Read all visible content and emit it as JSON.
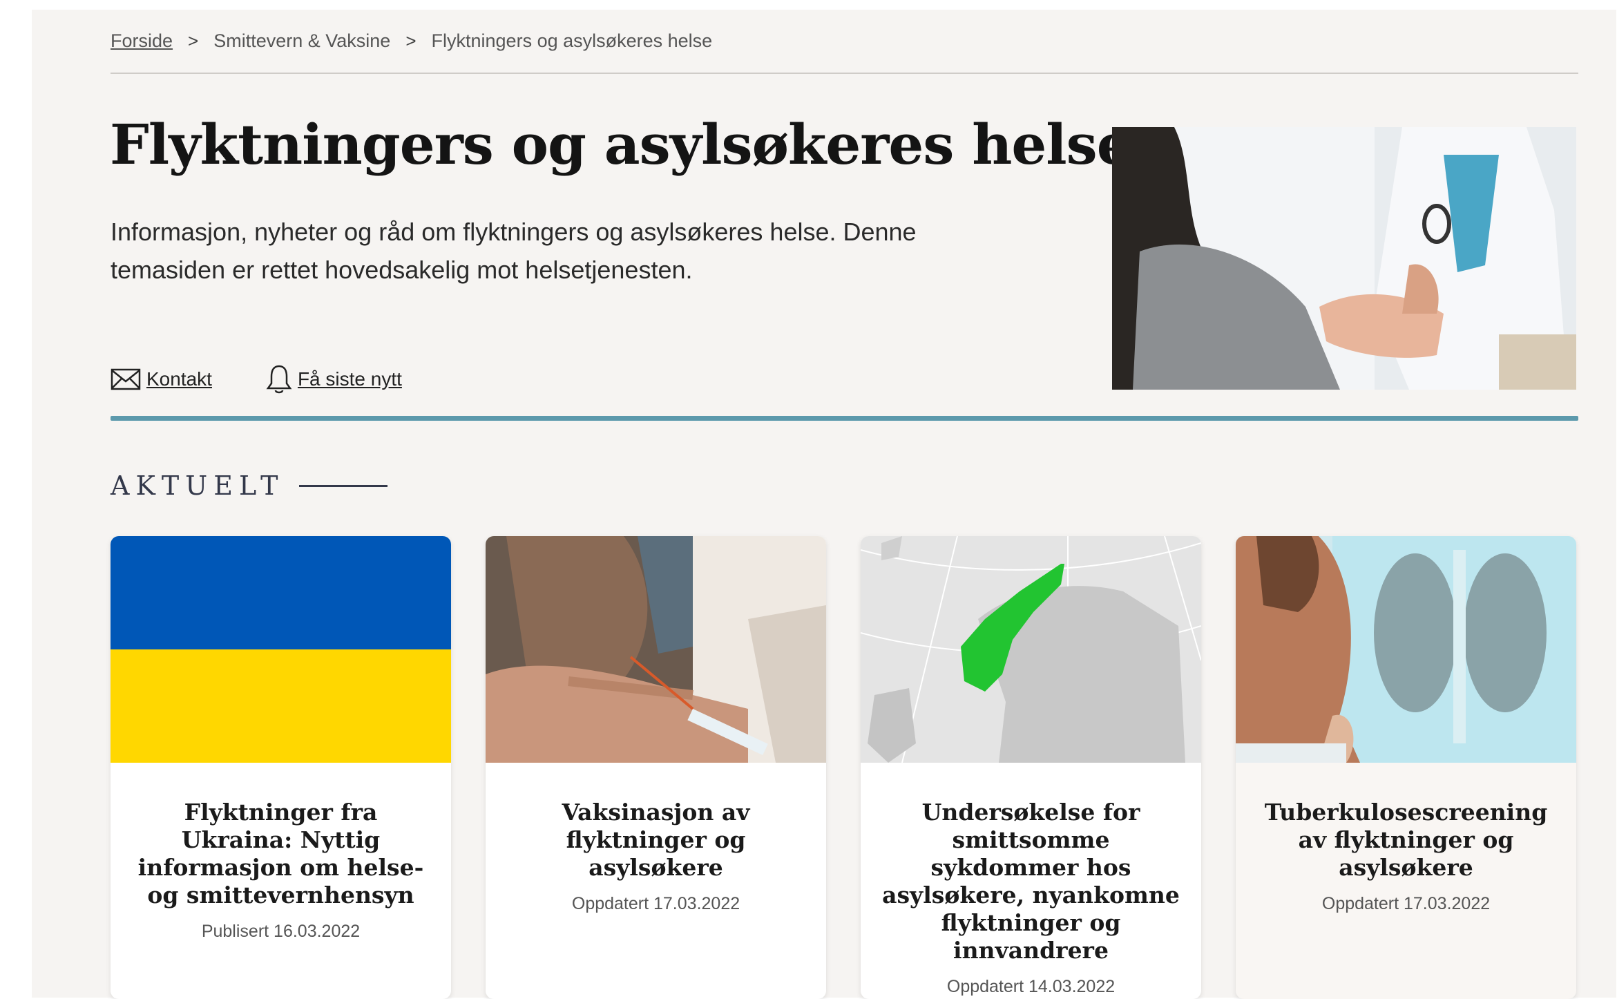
{
  "breadcrumb": {
    "home": "Forside",
    "section": "Smittevern & Vaksine",
    "current": "Flyktningers og asylsøkeres helse",
    "separator": ">"
  },
  "hero": {
    "title": "Flyktningers og asylsøkeres helse",
    "description": "Informasjon, nyheter og råd om flyktningers og asylsøkeres helse. Denne temasiden er rettet hovedsakelig mot helsetjenesten.",
    "image_icon": "doctor-patient-photo"
  },
  "actions": {
    "contact": "Kontakt",
    "subscribe": "Få siste nytt"
  },
  "section": {
    "heading": "AKTUELT"
  },
  "cards": [
    {
      "title": "Flyktninger fra Ukraina: Nyttig informasjon om helse- og smittevernhensyn",
      "date": "Publisert 16.03.2022",
      "image": "ukraine-flag"
    },
    {
      "title": "Vaksinasjon av flyktninger og asylsøkere",
      "date": "Oppdatert 17.03.2022",
      "image": "vaccination-photo"
    },
    {
      "title": "Undersøkelse for smittsomme sykdommer hos asylsøkere, nyankomne flyktninger og innvandrere",
      "date": "Oppdatert 14.03.2022",
      "image": "norway-map"
    },
    {
      "title": "Tuberkulosescreening av flyktninger og asylsøkere",
      "date": "Oppdatert 17.03.2022",
      "image": "xray-photo"
    }
  ],
  "colors": {
    "page_bg": "#f6f4f2",
    "accent": "#5c99ac",
    "flag_blue": "#0057b7",
    "flag_yellow": "#ffd700",
    "norway_green": "#22c431"
  }
}
